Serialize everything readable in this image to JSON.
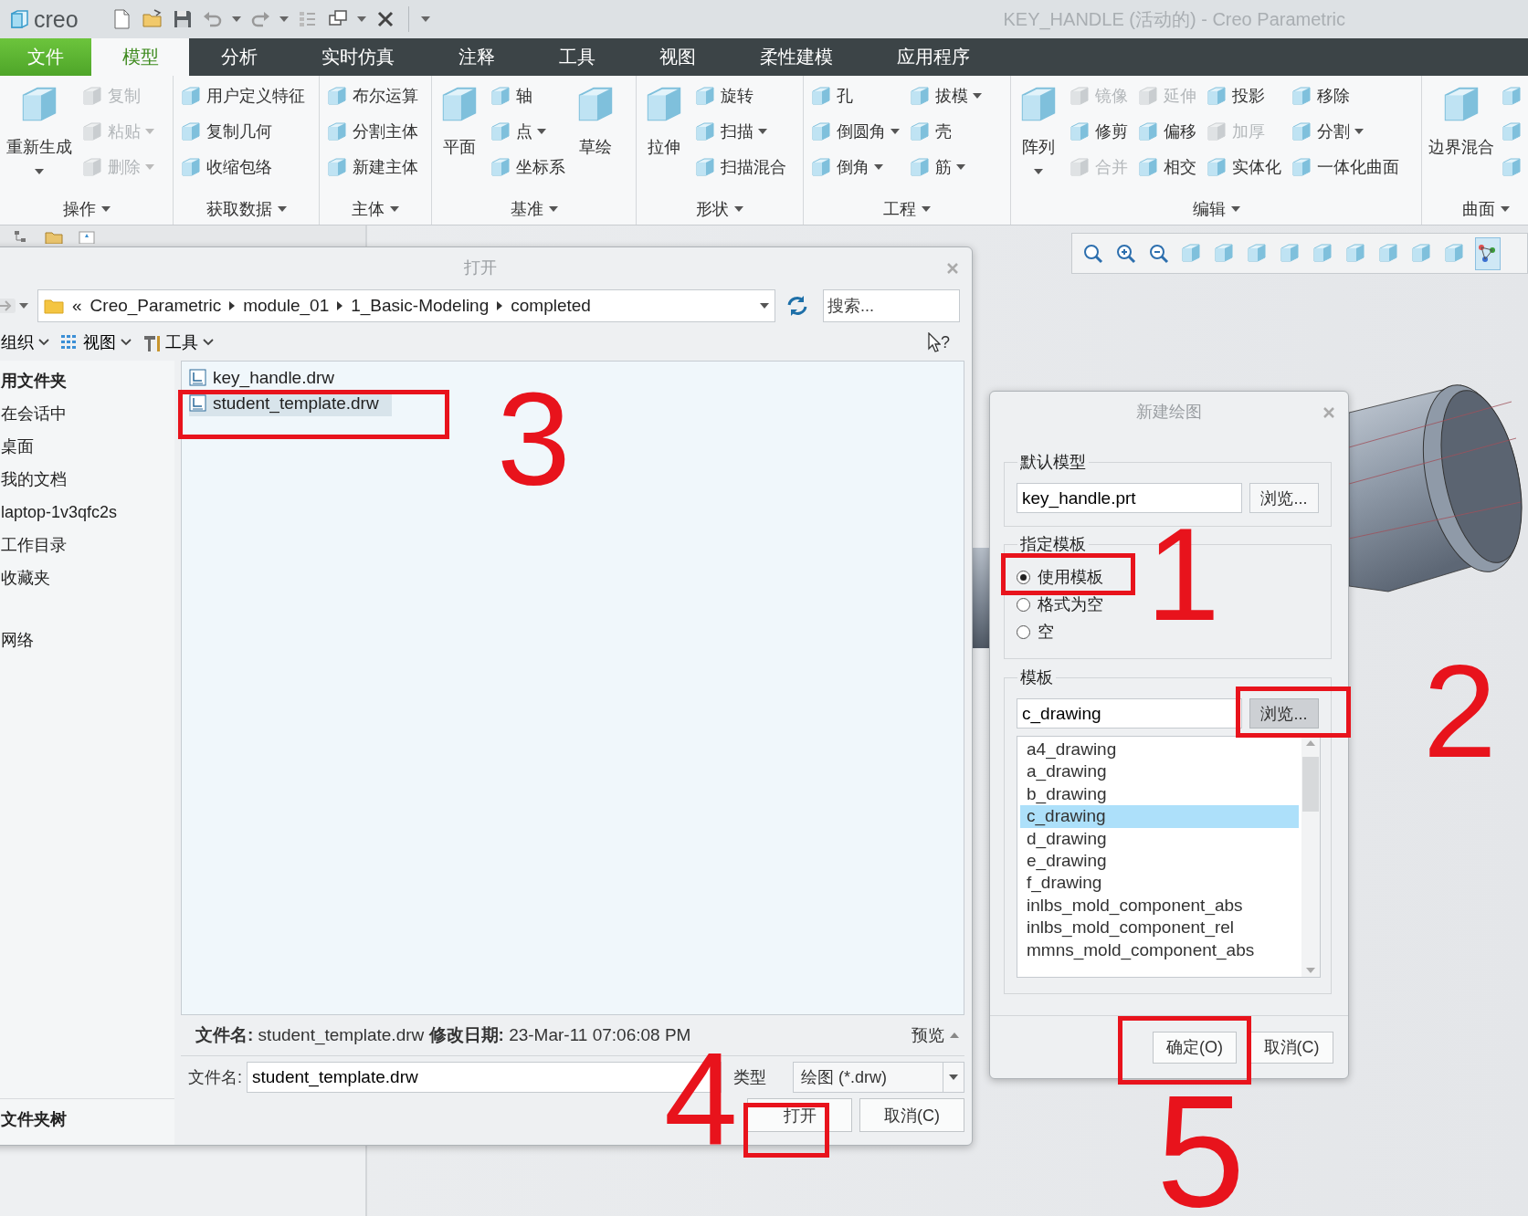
{
  "app": {
    "logo": "creo",
    "title": "KEY_HANDLE (活动的) - Creo Parametric"
  },
  "tabs": [
    {
      "label": "文件",
      "kind": "file",
      "selected": false
    },
    {
      "label": "模型",
      "kind": "tab",
      "selected": true
    },
    {
      "label": "分析",
      "kind": "tab",
      "selected": false
    },
    {
      "label": "实时仿真",
      "kind": "tab",
      "selected": false
    },
    {
      "label": "注释",
      "kind": "tab",
      "selected": false
    },
    {
      "label": "工具",
      "kind": "tab",
      "selected": false
    },
    {
      "label": "视图",
      "kind": "tab",
      "selected": false
    },
    {
      "label": "柔性建模",
      "kind": "tab",
      "selected": false
    },
    {
      "label": "应用程序",
      "kind": "tab",
      "selected": false
    }
  ],
  "ribbon": {
    "groups": [
      {
        "label": "操作",
        "columns": [
          [
            {
              "label": "重新生成",
              "kind": "large",
              "dropdown": true,
              "disabled": false
            }
          ],
          [
            {
              "label": "复制",
              "kind": "small",
              "dropdown": false,
              "disabled": true
            },
            {
              "label": "粘贴",
              "kind": "small",
              "dropdown": true,
              "disabled": true
            },
            {
              "label": "删除",
              "kind": "small",
              "dropdown": true,
              "disabled": true
            }
          ]
        ]
      },
      {
        "label": "获取数据",
        "columns": [
          [
            {
              "label": "用户定义特征",
              "kind": "small",
              "dropdown": false,
              "disabled": false
            },
            {
              "label": "复制几何",
              "kind": "small",
              "dropdown": false,
              "disabled": false
            },
            {
              "label": "收缩包络",
              "kind": "small",
              "dropdown": false,
              "disabled": false
            }
          ]
        ]
      },
      {
        "label": "主体",
        "columns": [
          [
            {
              "label": "布尔运算",
              "kind": "small",
              "dropdown": false,
              "disabled": false
            },
            {
              "label": "分割主体",
              "kind": "small",
              "dropdown": false,
              "disabled": false
            },
            {
              "label": "新建主体",
              "kind": "small",
              "dropdown": false,
              "disabled": false
            }
          ]
        ]
      },
      {
        "label": "基准",
        "columns": [
          [
            {
              "label": "平面",
              "kind": "large",
              "dropdown": false,
              "disabled": false
            }
          ],
          [
            {
              "label": "轴",
              "kind": "small",
              "dropdown": false,
              "disabled": false
            },
            {
              "label": "点",
              "kind": "small",
              "dropdown": true,
              "disabled": false
            },
            {
              "label": "坐标系",
              "kind": "small",
              "dropdown": false,
              "disabled": false
            }
          ],
          [
            {
              "label": "草绘",
              "kind": "large",
              "dropdown": false,
              "disabled": false
            }
          ]
        ]
      },
      {
        "label": "形状",
        "columns": [
          [
            {
              "label": "拉伸",
              "kind": "large",
              "dropdown": false,
              "disabled": false
            }
          ],
          [
            {
              "label": "旋转",
              "kind": "small",
              "dropdown": false,
              "disabled": false
            },
            {
              "label": "扫描",
              "kind": "small",
              "dropdown": true,
              "disabled": false
            },
            {
              "label": "扫描混合",
              "kind": "small",
              "dropdown": false,
              "disabled": false
            }
          ]
        ]
      },
      {
        "label": "工程",
        "columns": [
          [
            {
              "label": "孔",
              "kind": "small",
              "dropdown": false,
              "disabled": false
            },
            {
              "label": "倒圆角",
              "kind": "small",
              "dropdown": true,
              "disabled": false
            },
            {
              "label": "倒角",
              "kind": "small",
              "dropdown": true,
              "disabled": false
            }
          ],
          [
            {
              "label": "拔模",
              "kind": "small",
              "dropdown": true,
              "disabled": false
            },
            {
              "label": "壳",
              "kind": "small",
              "dropdown": false,
              "disabled": false
            },
            {
              "label": "筋",
              "kind": "small",
              "dropdown": true,
              "disabled": false
            }
          ]
        ]
      },
      {
        "label": "编辑",
        "columns": [
          [
            {
              "label": "阵列",
              "kind": "large",
              "dropdown": true,
              "disabled": false
            }
          ],
          [
            {
              "label": "镜像",
              "kind": "small",
              "dropdown": false,
              "disabled": true
            },
            {
              "label": "修剪",
              "kind": "small",
              "dropdown": false,
              "disabled": false
            },
            {
              "label": "合并",
              "kind": "small",
              "dropdown": false,
              "disabled": true
            }
          ],
          [
            {
              "label": "延伸",
              "kind": "small",
              "dropdown": false,
              "disabled": true
            },
            {
              "label": "偏移",
              "kind": "small",
              "dropdown": false,
              "disabled": false
            },
            {
              "label": "相交",
              "kind": "small",
              "dropdown": false,
              "disabled": false
            }
          ],
          [
            {
              "label": "投影",
              "kind": "small",
              "dropdown": false,
              "disabled": false
            },
            {
              "label": "加厚",
              "kind": "small",
              "dropdown": false,
              "disabled": true
            },
            {
              "label": "实体化",
              "kind": "small",
              "dropdown": false,
              "disabled": false
            }
          ],
          [
            {
              "label": "移除",
              "kind": "small",
              "dropdown": false,
              "disabled": false
            },
            {
              "label": "分割",
              "kind": "small",
              "dropdown": true,
              "disabled": false
            },
            {
              "label": "一体化曲面",
              "kind": "small",
              "dropdown": false,
              "disabled": false
            }
          ]
        ]
      },
      {
        "label": "曲面",
        "columns": [
          [
            {
              "label": "边界混合",
              "kind": "large",
              "dropdown": false,
              "disabled": false
            }
          ],
          [
            {
              "kind": "icon",
              "dropdown": false,
              "disabled": false
            },
            {
              "kind": "icon",
              "dropdown": false,
              "disabled": false
            },
            {
              "kind": "icon",
              "dropdown": false,
              "disabled": false
            }
          ]
        ]
      }
    ]
  },
  "view_toolbar": [
    {
      "selected": false
    },
    {
      "selected": false
    },
    {
      "selected": false
    },
    {
      "selected": false
    },
    {
      "selected": false
    },
    {
      "selected": false
    },
    {
      "selected": false
    },
    {
      "selected": false
    },
    {
      "selected": false
    },
    {
      "selected": false
    },
    {
      "selected": false
    },
    {
      "selected": false
    },
    {
      "selected": true
    }
  ],
  "open_dialog": {
    "title": "打开",
    "path": {
      "overflow": "«",
      "segments": [
        "Creo_Parametric",
        "module_01",
        "1_Basic-Modeling",
        "completed"
      ]
    },
    "search": {
      "placeholder": "搜索..."
    },
    "toolbar": [
      {
        "label": "组织"
      },
      {
        "label": "视图"
      },
      {
        "label": "工具"
      }
    ],
    "help": "?",
    "places": [
      {
        "label": "用文件夹",
        "kind": "header"
      },
      {
        "label": "在会话中",
        "kind": "item"
      },
      {
        "label": "桌面",
        "kind": "item"
      },
      {
        "label": "我的文档",
        "kind": "item"
      },
      {
        "label": "laptop-1v3qfc2s",
        "kind": "item"
      },
      {
        "label": "工作目录",
        "kind": "item"
      },
      {
        "label": "收藏夹",
        "kind": "item"
      },
      {
        "label": "网络",
        "kind": "spaced"
      }
    ],
    "folder_tree": "文件夹树",
    "files": [
      {
        "name": "key_handle.drw",
        "selected": false
      },
      {
        "name": "student_template.drw",
        "selected": true
      }
    ],
    "info": "**文件名:** student_template.drw  **修改日期:** 23-Mar-11 07:06:08 PM",
    "preview": "预览",
    "filename": {
      "label": "文件名:",
      "value": "student_template.drw"
    },
    "type": {
      "label": "类型",
      "value": "绘图 (*.drw)"
    },
    "buttons": [
      "打开",
      "取消(C)"
    ]
  },
  "new_drawing": {
    "title": "新建绘图",
    "default_model": {
      "legend": "默认模型",
      "value": "key_handle.prt",
      "browse": {
        "label": "浏览...",
        "pressed": false
      }
    },
    "template_mode": {
      "legend": "指定模板",
      "options": [
        {
          "label": "使用模板",
          "selected": true
        },
        {
          "label": "格式为空",
          "selected": false
        },
        {
          "label": "空",
          "selected": false
        }
      ]
    },
    "template": {
      "legend": "模板",
      "value": "c_drawing",
      "browse": {
        "label": "浏览...",
        "pressed": true
      }
    },
    "templates": [
      {
        "name": "a4_drawing",
        "selected": false
      },
      {
        "name": "a_drawing",
        "selected": false
      },
      {
        "name": "b_drawing",
        "selected": false
      },
      {
        "name": "c_drawing",
        "selected": true
      },
      {
        "name": "d_drawing",
        "selected": false
      },
      {
        "name": "e_drawing",
        "selected": false
      },
      {
        "name": "f_drawing",
        "selected": false
      },
      {
        "name": "inlbs_mold_component_abs",
        "selected": false
      },
      {
        "name": "inlbs_mold_component_rel",
        "selected": false
      },
      {
        "name": "mmns_mold_component_abs",
        "selected": false
      }
    ],
    "buttons": [
      "确定(O)",
      "取消(C)"
    ]
  },
  "annotations": [
    {
      "label": "1"
    },
    {
      "label": "2"
    },
    {
      "label": "3"
    },
    {
      "label": "4"
    },
    {
      "label": "5"
    }
  ]
}
